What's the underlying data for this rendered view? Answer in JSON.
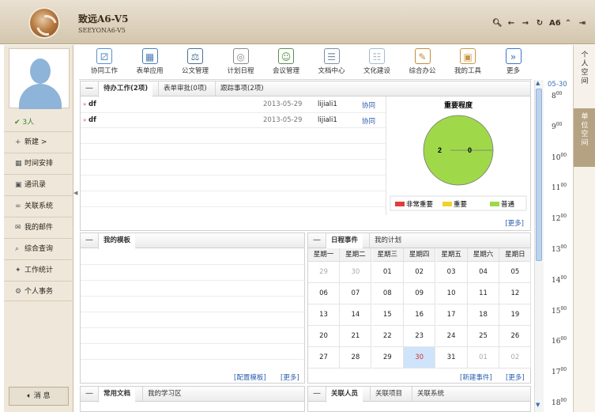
{
  "header": {
    "title": "致远A6-V5",
    "subtitle": "SEEYONA6-V5",
    "icons": [
      "search-icon",
      "back-arrow-icon",
      "forward-arrow-icon",
      "refresh-icon",
      "font-size-icon",
      "collapse-up-icon",
      "logout-icon"
    ],
    "font_size_label": "A6"
  },
  "sidebar": {
    "online": "3人",
    "items": [
      {
        "label": "新建 >",
        "icon": "plus-icon"
      },
      {
        "label": "时间安排",
        "icon": "calendar-icon"
      },
      {
        "label": "通讯录",
        "icon": "contacts-icon"
      },
      {
        "label": "关联系统",
        "icon": "link-icon"
      },
      {
        "label": "我的邮件",
        "icon": "mail-icon"
      },
      {
        "label": "综合查询",
        "icon": "search-icon"
      },
      {
        "label": "工作统计",
        "icon": "puzzle-icon"
      },
      {
        "label": "个人事务",
        "icon": "gear-icon"
      }
    ],
    "message_label": "消 息"
  },
  "toolbar": {
    "items": [
      {
        "label": "协同工作",
        "color": "#5b8fc7"
      },
      {
        "label": "表单应用",
        "color": "#4a7fb5"
      },
      {
        "label": "公文管理",
        "color": "#4d6f93"
      },
      {
        "label": "计划日程",
        "color": "#8a8a8a"
      },
      {
        "label": "会议管理",
        "color": "#5a8e4a"
      },
      {
        "label": "文档中心",
        "color": "#7a8fa8"
      },
      {
        "label": "文化建设",
        "color": "#a9b9cc"
      },
      {
        "label": "综合办公",
        "color": "#c58a3a"
      },
      {
        "label": "我的工具",
        "color": "#c99645"
      },
      {
        "label": "更多",
        "color": "#3a77c4"
      }
    ]
  },
  "todo_panel": {
    "tabs": [
      "待办工作(2项)",
      "表单审批(0项)",
      "跟踪事项(2项)"
    ],
    "rows": [
      {
        "title": "df",
        "date": "2013-05-29",
        "user": "lijiali1",
        "type": "协同"
      },
      {
        "title": "df",
        "date": "2013-05-29",
        "user": "lijiali1",
        "type": "协同"
      }
    ],
    "more": "[更多]",
    "chart_data": {
      "type": "pie",
      "title": "重要程度",
      "slices": [
        {
          "label": "非常重要",
          "value": 0,
          "color": "#e23b3b"
        },
        {
          "label": "重要",
          "value": 0,
          "color": "#f2d22a"
        },
        {
          "label": "普通",
          "value": 2,
          "color": "#9fd94a"
        }
      ],
      "data_labels": [
        "2",
        "0"
      ],
      "legend_position": "bottom"
    }
  },
  "template_panel": {
    "tab": "我的模板",
    "config_link": "[配置模板]",
    "more": "[更多]"
  },
  "calendar_panel": {
    "tabs": [
      "日程事件",
      "我的计划"
    ],
    "weekdays": [
      "星期一",
      "星期二",
      "星期三",
      "星期四",
      "星期五",
      "星期六",
      "星期日"
    ],
    "weeks": [
      [
        "29",
        "30",
        "01",
        "02",
        "03",
        "04",
        "05"
      ],
      [
        "06",
        "07",
        "08",
        "09",
        "10",
        "11",
        "12"
      ],
      [
        "13",
        "14",
        "15",
        "16",
        "17",
        "18",
        "19"
      ],
      [
        "20",
        "21",
        "22",
        "23",
        "24",
        "25",
        "26"
      ],
      [
        "27",
        "28",
        "29",
        "30",
        "31",
        "01",
        "02"
      ]
    ],
    "today": "30",
    "new_event": "[新建事件]",
    "more": "[更多]"
  },
  "docs_panel": {
    "tabs": [
      "常用文档",
      "我的学习区"
    ]
  },
  "related_panel": {
    "tabs": [
      "关联人员",
      "关联项目",
      "关联系统"
    ]
  },
  "timeline": {
    "date": "05-30",
    "hours": [
      "8",
      "9",
      "10",
      "11",
      "12",
      "13",
      "14",
      "15",
      "16",
      "17",
      "18"
    ],
    "minutes": "00"
  },
  "right_tabs": [
    "个人空间",
    "单位空间"
  ]
}
